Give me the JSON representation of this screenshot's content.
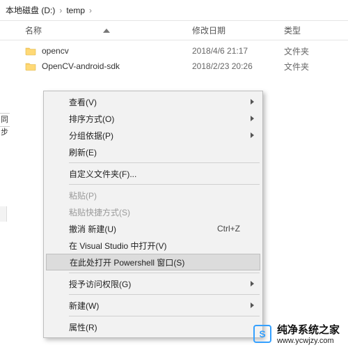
{
  "breadcrumb": {
    "parts": [
      "本地磁盘 (D:)",
      "temp"
    ],
    "sep": "›"
  },
  "columns": {
    "name": "名称",
    "date": "修改日期",
    "type": "类型"
  },
  "files": [
    {
      "icon": "folder",
      "name": "opencv",
      "date": "2018/4/6 21:17",
      "type": "文件夹"
    },
    {
      "icon": "folder",
      "name": "OpenCV-android-sdk",
      "date": "2018/2/23 20:26",
      "type": "文件夹"
    }
  ],
  "left_stub": "同步",
  "context_menu": {
    "items": [
      {
        "label": "查看(V)",
        "submenu": true
      },
      {
        "label": "排序方式(O)",
        "submenu": true
      },
      {
        "label": "分组依据(P)",
        "submenu": true
      },
      {
        "label": "刷新(E)"
      },
      {
        "sep": true
      },
      {
        "label": "自定义文件夹(F)..."
      },
      {
        "sep": true
      },
      {
        "label": "粘贴(P)",
        "disabled": true
      },
      {
        "label": "粘贴快捷方式(S)",
        "disabled": true
      },
      {
        "label": "撤消 新建(U)",
        "shortcut": "Ctrl+Z"
      },
      {
        "label": "在 Visual Studio 中打开(V)"
      },
      {
        "label": "在此处打开 Powershell 窗口(S)",
        "highlight": true
      },
      {
        "sep": true
      },
      {
        "label": "授予访问权限(G)",
        "submenu": true
      },
      {
        "sep": true
      },
      {
        "label": "新建(W)",
        "submenu": true
      },
      {
        "sep": true
      },
      {
        "label": "属性(R)"
      }
    ]
  },
  "watermark": {
    "logo_letter": "S",
    "title": "纯净系统之家",
    "url": "www.ycwjzy.com"
  }
}
